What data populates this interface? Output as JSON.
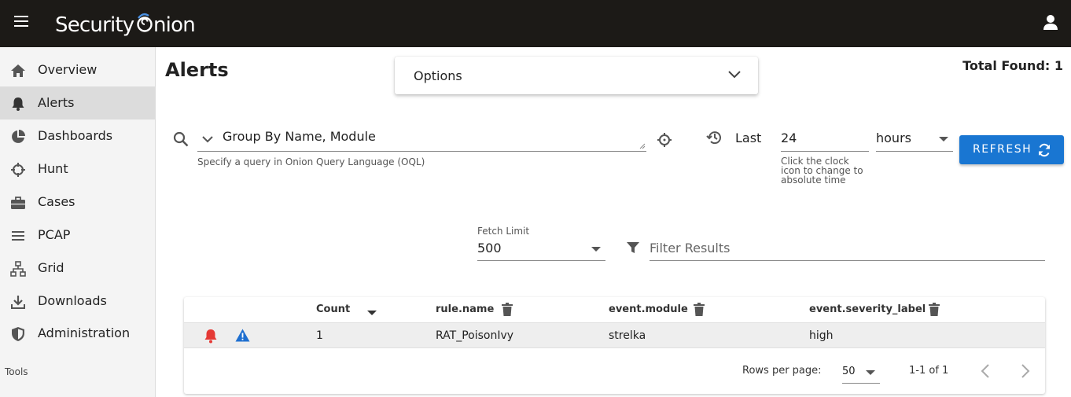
{
  "app": {
    "logo_text": "SecurityOnion"
  },
  "colors": {
    "topbar": "#1c1a17",
    "accent": "#1976d2",
    "alert_red": "#e53935",
    "warn_blue": "#1e6fd0"
  },
  "sidebar": {
    "items": [
      {
        "label": "Overview",
        "icon": "home-icon"
      },
      {
        "label": "Alerts",
        "icon": "bell-icon",
        "active": true
      },
      {
        "label": "Dashboards",
        "icon": "pie-chart-icon"
      },
      {
        "label": "Hunt",
        "icon": "crosshair-icon"
      },
      {
        "label": "Cases",
        "icon": "briefcase-icon"
      },
      {
        "label": "PCAP",
        "icon": "list-icon"
      },
      {
        "label": "Grid",
        "icon": "sitemap-icon"
      },
      {
        "label": "Downloads",
        "icon": "download-icon"
      },
      {
        "label": "Administration",
        "icon": "shield-icon"
      }
    ],
    "tools_label": "Tools"
  },
  "main": {
    "title": "Alerts",
    "options_label": "Options",
    "total_found": "Total Found: 1",
    "query": {
      "value": "Group By Name, Module",
      "hint": "Specify a query in Onion Query Language (OQL)"
    },
    "time": {
      "last_label": "Last",
      "value": "24",
      "units": "hours",
      "hint": "Click the clock icon to change to absolute time"
    },
    "refresh_label": "REFRESH",
    "fetch_limit": {
      "label": "Fetch Limit",
      "value": "500"
    },
    "filter_placeholder": "Filter Results"
  },
  "table": {
    "headers": {
      "count": "Count",
      "rule": "rule.name",
      "module": "event.module",
      "severity": "event.severity_label"
    },
    "rows": [
      {
        "count": "1",
        "rule": "RAT_PoisonIvy",
        "module": "strelka",
        "severity": "high"
      }
    ],
    "footer": {
      "rows_per_page_label": "Rows per page:",
      "rows_per_page": "50",
      "range": "1-1 of 1"
    }
  }
}
